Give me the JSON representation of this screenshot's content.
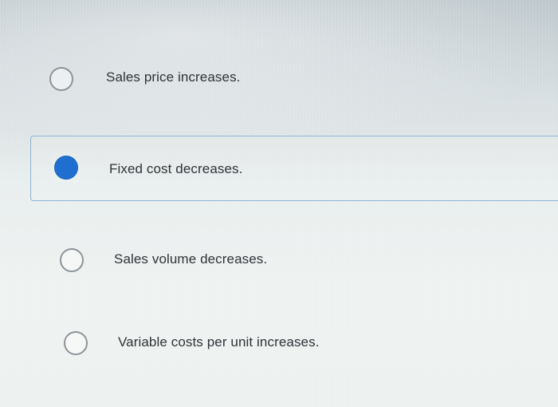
{
  "question": {
    "options": [
      {
        "label": "Sales price increases.",
        "selected": false
      },
      {
        "label": "Fixed cost decreases.",
        "selected": true
      },
      {
        "label": "Sales volume decreases.",
        "selected": false
      },
      {
        "label": "Variable costs per unit increases.",
        "selected": false
      }
    ],
    "colors": {
      "selected_fill": "#1f6fd1",
      "selected_border": "#8fb5d2",
      "radio_border": "#8d9498",
      "text": "#2f3338"
    }
  }
}
